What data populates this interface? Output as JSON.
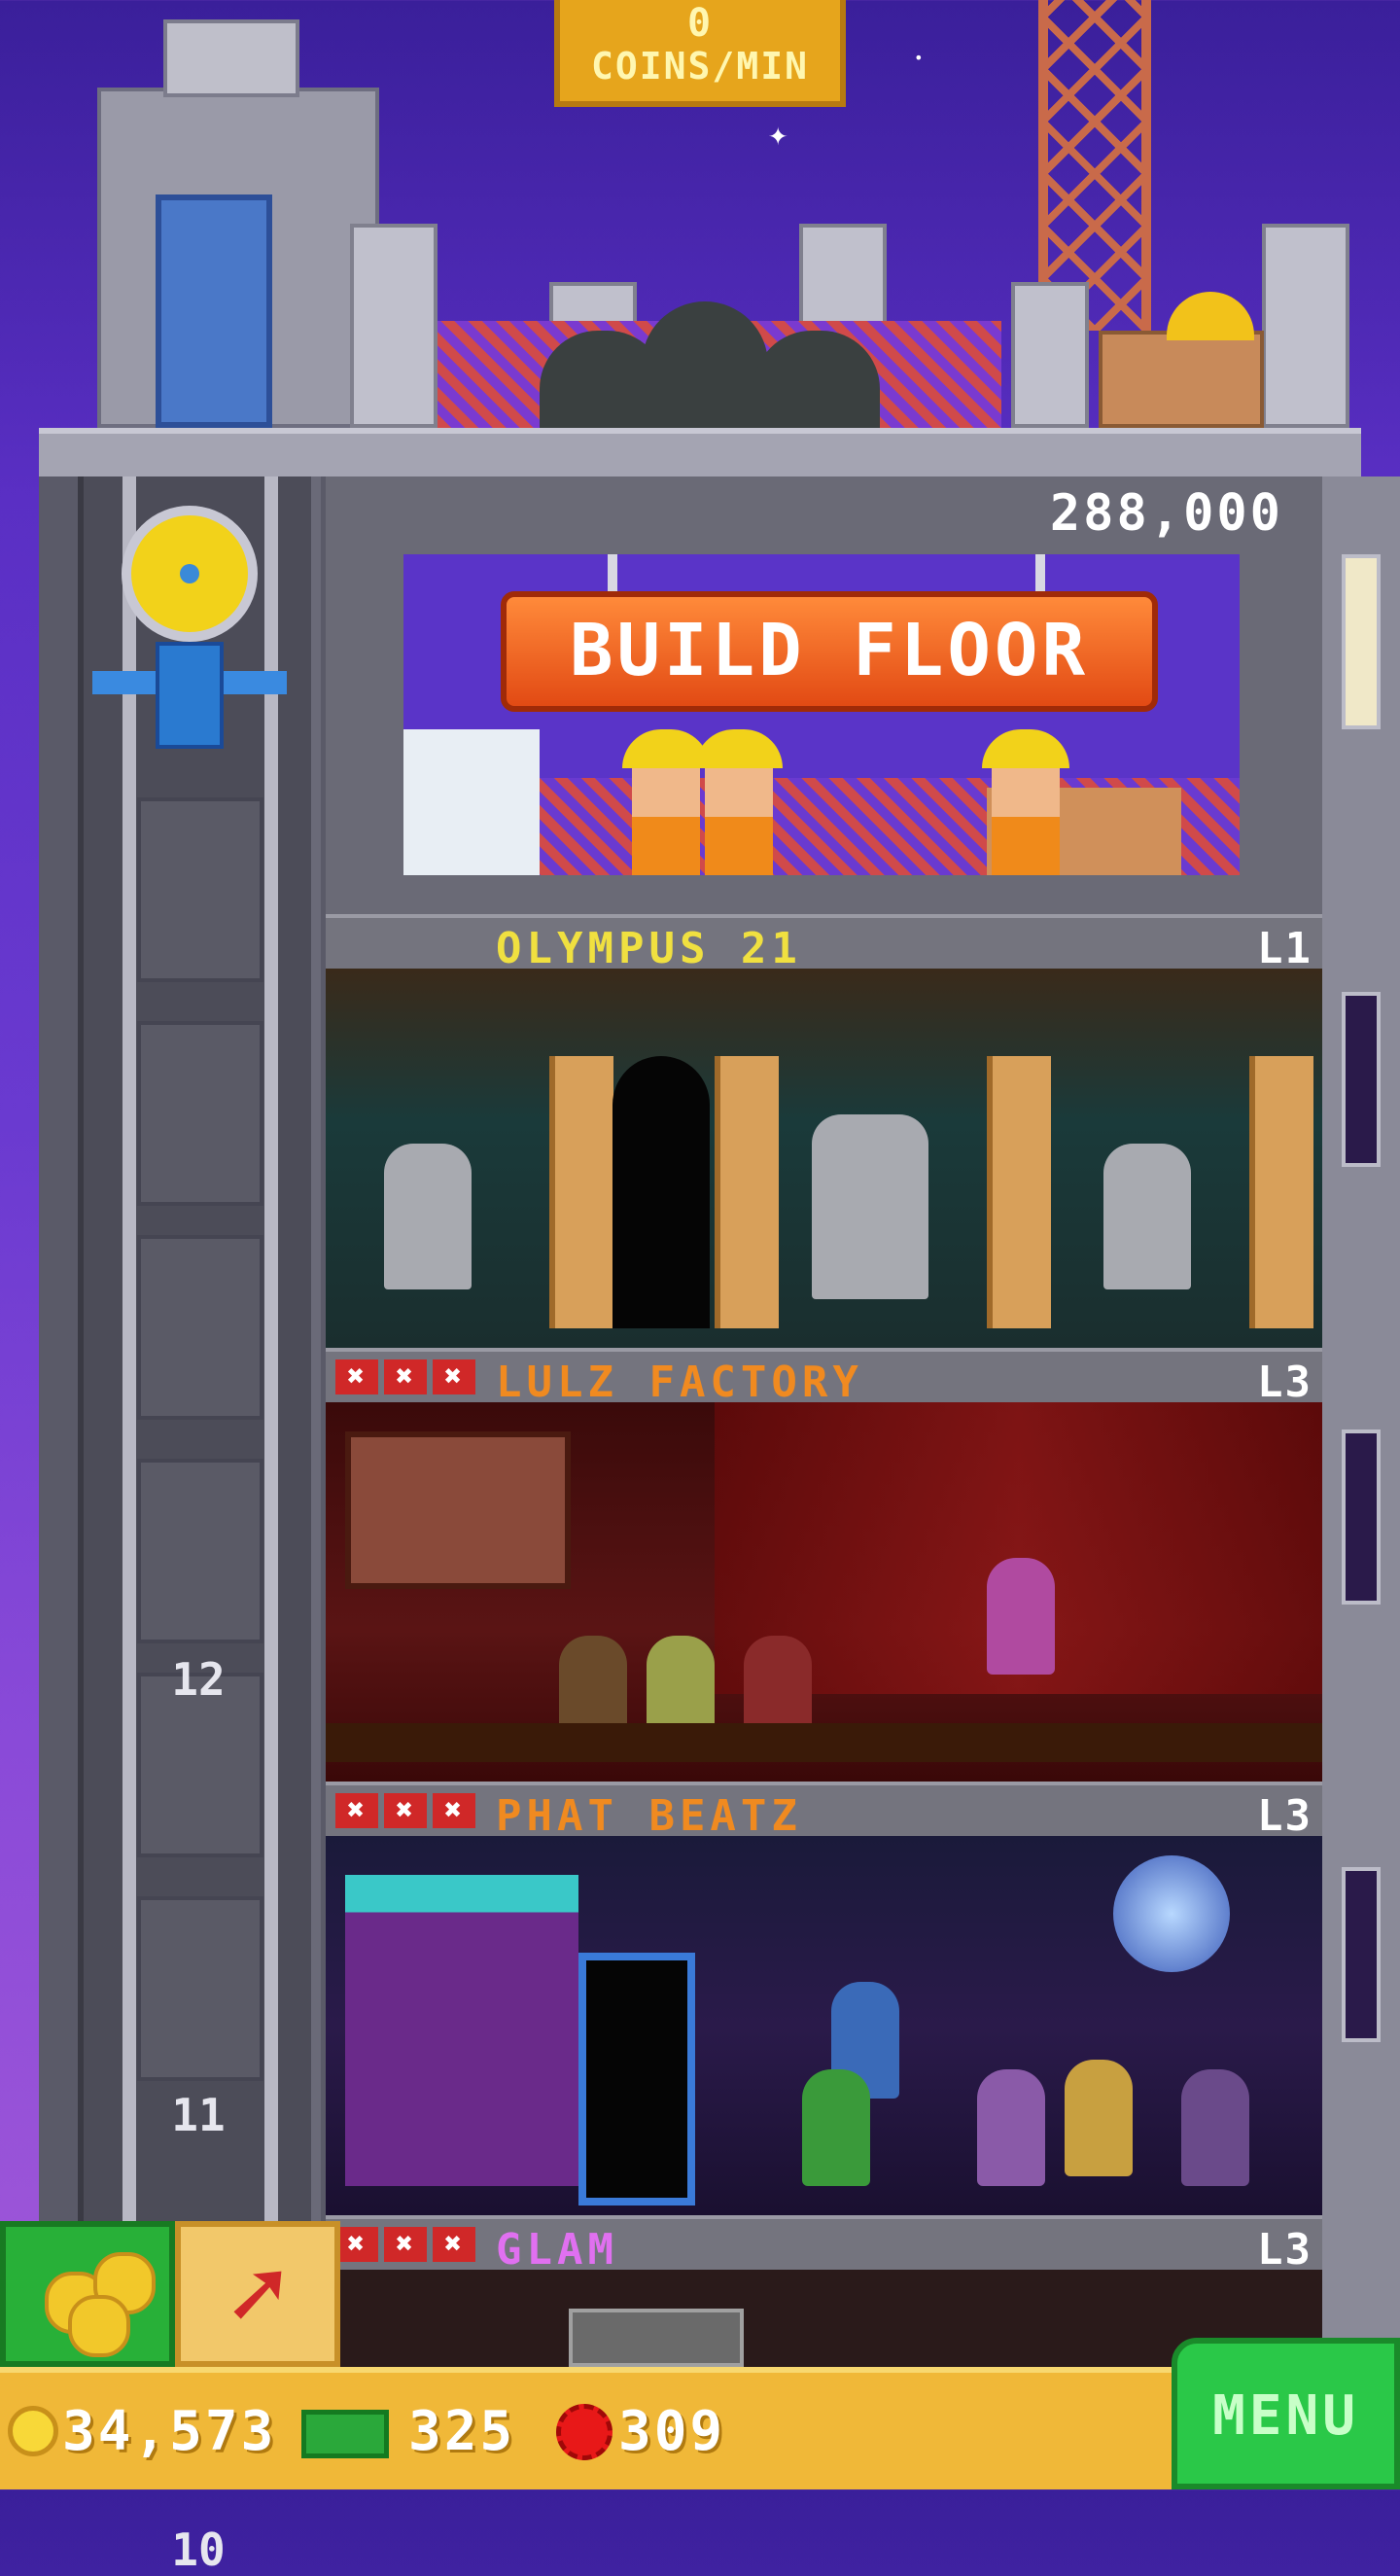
{
  "hud_top": {
    "coins_rate": "0",
    "coins_rate_unit": "COINS/MIN"
  },
  "build": {
    "price": "288,000",
    "button_label": "BUILD FLOOR"
  },
  "floors": [
    {
      "name": "OLYMPUS 21",
      "level": "L1",
      "name_color": "#f0e040",
      "stars": []
    },
    {
      "name": "LULZ FACTORY",
      "level": "L3",
      "name_color": "#f08a20",
      "stars": [
        "✖",
        "✖",
        "✖"
      ]
    },
    {
      "name": "PHAT BEATZ",
      "level": "L3",
      "name_color": "#f08a20",
      "stars": [
        "✖",
        "✖",
        "✖"
      ]
    },
    {
      "name": "GLAM",
      "level": "L3",
      "name_color": "#e070f0",
      "stars": [
        "✖",
        "✖",
        "✖"
      ]
    }
  ],
  "elevator_floor_numbers": [
    "12",
    "11",
    "10"
  ],
  "hud": {
    "coins": "34,573",
    "bux": "325",
    "gems": "309",
    "menu_label": "MENU"
  },
  "icons": {
    "coins_button": "coin-stack-icon",
    "hammer_button": "hammer-icon",
    "coin": "coin-icon",
    "bux": "bux-icon",
    "gem": "gem-icon"
  },
  "colors": {
    "sky": "#5a2fc4",
    "hud_bar": "#f0b838",
    "menu_button": "#2ac848",
    "build_button": "#e24a14"
  }
}
